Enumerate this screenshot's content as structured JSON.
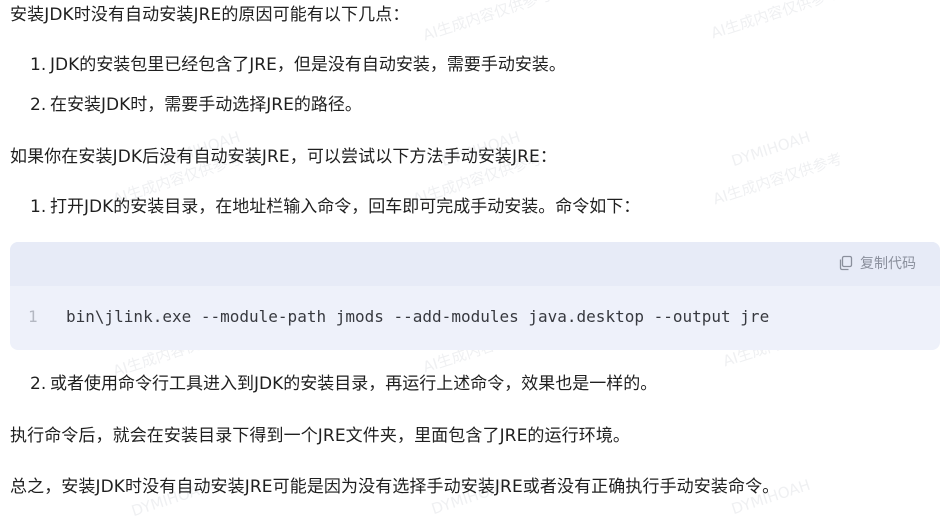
{
  "content": {
    "intro": "安装JDK时没有自动安装JRE的原因可能有以下几点：",
    "reasons": [
      {
        "num": "1.",
        "text": "JDK的安装包里已经包含了JRE，但是没有自动安装，需要手动安装。"
      },
      {
        "num": "2.",
        "text": "在安装JDK时，需要手动选择JRE的路径。"
      }
    ],
    "solution_intro": "如果你在安装JDK后没有自动安装JRE，可以尝试以下方法手动安装JRE：",
    "steps": [
      {
        "num": "1.",
        "text": "打开JDK的安装目录，在地址栏输入命令，回车即可完成手动安装。命令如下："
      },
      {
        "num": "2.",
        "text": "或者使用命令行工具进入到JDK的安装目录，再运行上述命令，效果也是一样的。"
      }
    ],
    "code_block": {
      "copy_label": "复制代码",
      "line_number": "1",
      "code": "bin\\jlink.exe --module-path jmods --add-modules java.desktop --output jre"
    },
    "result": "执行命令后，就会在安装目录下得到一个JRE文件夹，里面包含了JRE的运行环境。",
    "summary": "总之，安装JDK时没有自动安装JRE可能是因为没有选择手动安装JRE或者没有正确执行手动安装命令。"
  },
  "watermark": {
    "line1": "DYMIHOAH",
    "line2": "AI生成内容仅供参考"
  },
  "colors": {
    "text": "#1f1f1f",
    "code_bg": "#eef1fa",
    "code_header_bg": "#e7ebf7",
    "muted": "#8a8f9c"
  },
  "icons": {
    "copy": "copy-icon"
  }
}
